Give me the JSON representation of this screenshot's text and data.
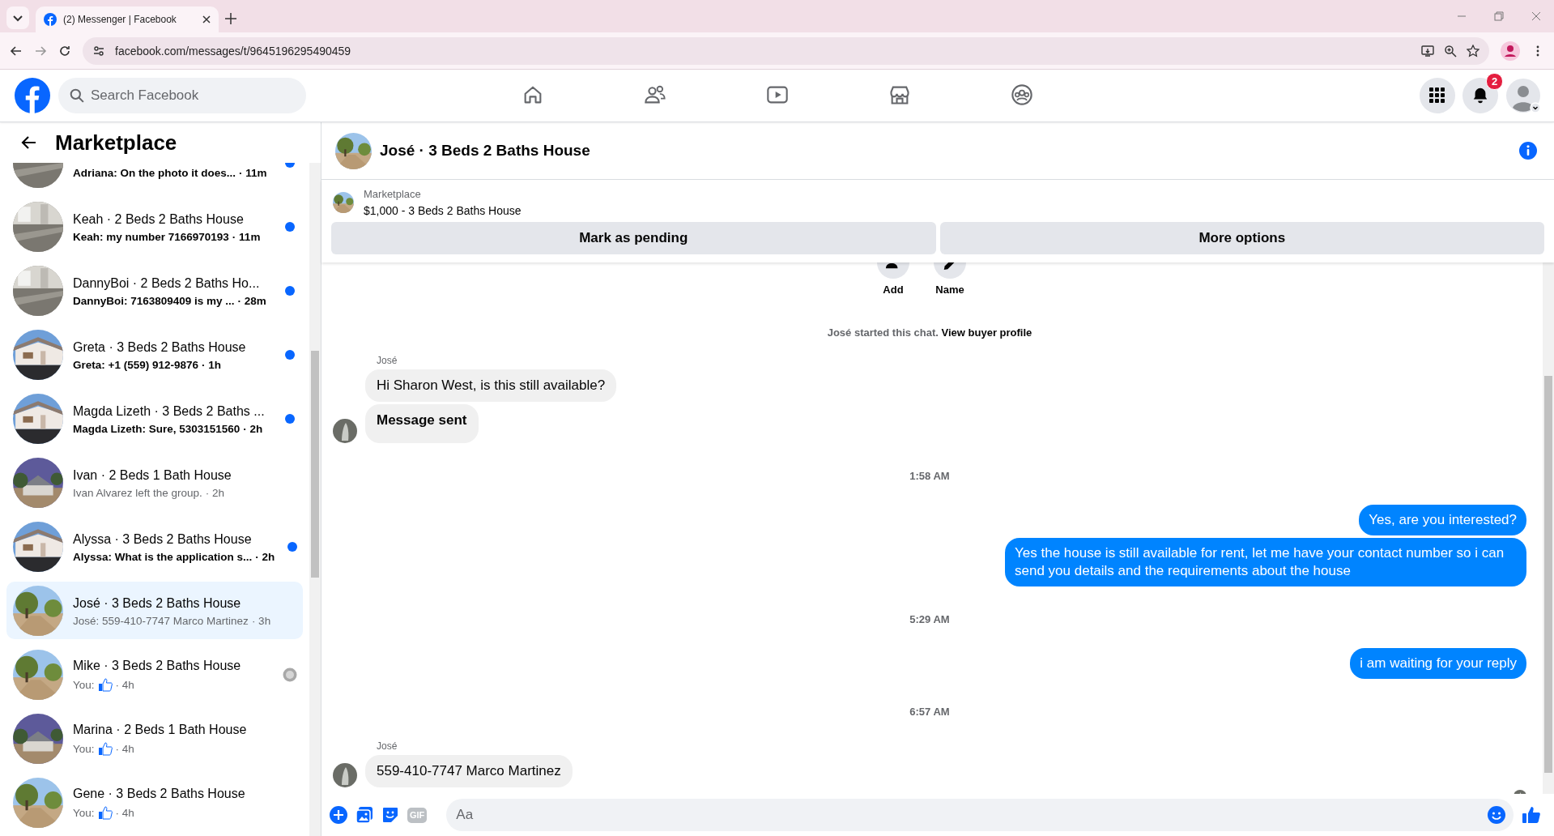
{
  "browser": {
    "tab_title": "(2) Messenger | Facebook",
    "url": "facebook.com/messages/t/9645196295490459"
  },
  "topbar": {
    "search_placeholder": "Search Facebook",
    "nav": [
      {
        "selected": false
      },
      {
        "selected": false
      },
      {
        "selected": false
      },
      {
        "selected": false
      },
      {
        "selected": false
      }
    ],
    "notification_count": "2"
  },
  "sidebar": {
    "title": "Marketplace",
    "conversations": [
      {
        "kind": "text",
        "preview": "Adriana: On the photo it does...",
        "time": "· 11m",
        "unread": true,
        "seen": false,
        "selected": false
      },
      {
        "kind": "text",
        "title": "Keah · 2 Beds 2 Baths House",
        "preview": "Keah: my number 7166970193",
        "time": "· 11m",
        "unread": true,
        "seen": false,
        "selected": false
      },
      {
        "kind": "text",
        "title": "DannyBoi · 2 Beds 2 Baths Ho...",
        "preview": "DannyBoi: 7163809409 is my ...",
        "time": "· 28m",
        "unread": true,
        "seen": false,
        "selected": false
      },
      {
        "kind": "text",
        "title": "Greta · 3 Beds 2 Baths House",
        "preview": "Greta: +1 (559) 912-9876",
        "time": "· 1h",
        "unread": true,
        "seen": false,
        "selected": false
      },
      {
        "kind": "text",
        "title": "Magda Lizeth · 3 Beds 2 Baths ...",
        "preview": "Magda Lizeth: Sure, 5303151560",
        "time": "· 2h",
        "unread": true,
        "seen": false,
        "selected": false
      },
      {
        "kind": "text",
        "title": "Ivan · 2 Beds 1 Bath House",
        "preview": "Ivan Alvarez left the group.",
        "time": "· 2h",
        "unread": false,
        "seen": false,
        "selected": false
      },
      {
        "kind": "text",
        "title": "Alyssa · 3 Beds 2 Baths House",
        "preview": "Alyssa: What is the application s...",
        "time": "· 2h",
        "unread": true,
        "seen": false,
        "selected": false
      },
      {
        "kind": "text",
        "title": "José · 3 Beds 2 Baths House",
        "preview": "José: 559-410-7747 Marco Martinez",
        "time": "· 3h",
        "unread": false,
        "seen": false,
        "selected": true
      },
      {
        "kind": "like",
        "title": "Mike · 3 Beds 2 Baths House",
        "preview": "You:",
        "time": "· 4h",
        "unread": false,
        "seen": true,
        "selected": false
      },
      {
        "kind": "like",
        "title": "Marina · 2 Beds 1 Bath House",
        "preview": "You:",
        "time": "· 4h",
        "unread": false,
        "seen": false,
        "selected": false
      },
      {
        "kind": "like",
        "title": "Gene · 3 Beds 2 Baths House",
        "preview": "You:",
        "time": "· 4h",
        "unread": false,
        "seen": false,
        "selected": false
      }
    ]
  },
  "chat": {
    "title": "José · 3 Beds 2 Baths House",
    "listing": {
      "label": "Marketplace",
      "summary": "$1,000 - 3 Beds 2 Baths House"
    },
    "actions": [
      "Mark as pending",
      "More options"
    ],
    "quick_actions": [
      {
        "label": "Add"
      },
      {
        "label": "Name"
      }
    ],
    "messages": [
      {
        "kind": "system",
        "text": "José started this chat.",
        "link": "View buyer profile"
      },
      {
        "kind": "sender",
        "text": "José"
      },
      {
        "kind": "incoming",
        "text": "Hi Sharon West, is this still available?",
        "bold": false,
        "avatar": false
      },
      {
        "kind": "incoming",
        "text": "Message sent",
        "bold": true,
        "avatar": true
      },
      {
        "kind": "timestamp",
        "text": "1:58 AM"
      },
      {
        "kind": "outgoing",
        "text": "Yes, are you interested?"
      },
      {
        "kind": "outgoing",
        "text": "Yes the house is still available for rent, let me have your contact number so i can send you details and the requirements about the house"
      },
      {
        "kind": "timestamp",
        "text": "5:29 AM"
      },
      {
        "kind": "outgoing",
        "text": "i am waiting for your reply"
      },
      {
        "kind": "timestamp",
        "text": "6:57 AM"
      },
      {
        "kind": "sender",
        "text": "José"
      },
      {
        "kind": "incoming",
        "text": "559-410-7747  Marco Martinez",
        "bold": false,
        "avatar": true
      }
    ],
    "composer": {
      "gif_label": "GIF",
      "placeholder": "Aa"
    }
  }
}
